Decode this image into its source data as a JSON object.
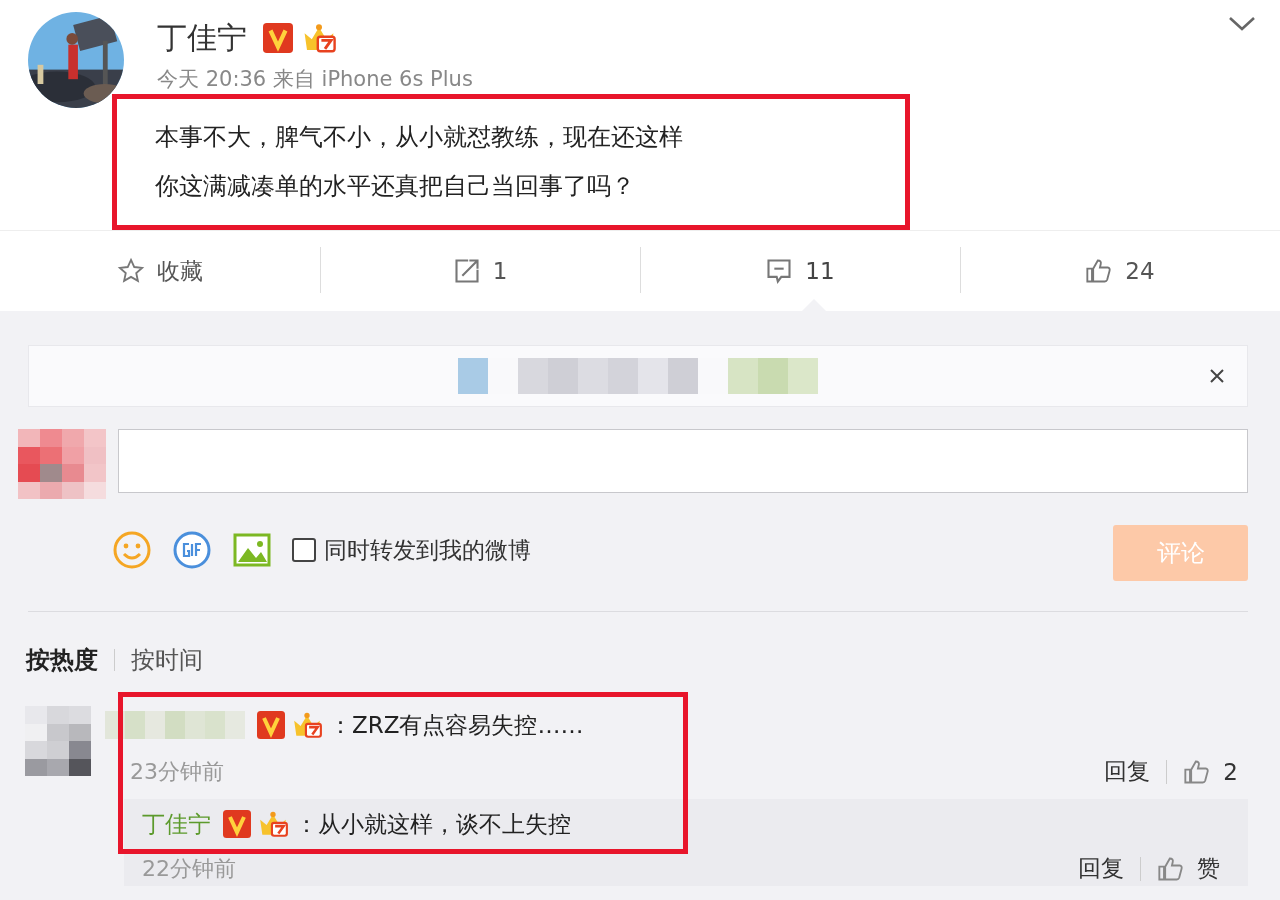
{
  "post": {
    "author": "丁佳宁",
    "verified": true,
    "meta": "今天 20:36 来自 iPhone 6s Plus",
    "lines": [
      "本事不大，脾气不小，从小就怼教练，现在还这样",
      "你这满减凑单的水平还真把自己当回事了吗？"
    ]
  },
  "actions": [
    {
      "kind": "favorite",
      "label": "收藏",
      "selected": false
    },
    {
      "kind": "repost",
      "label": "1",
      "selected": false
    },
    {
      "kind": "comment",
      "label": "11",
      "selected": true
    },
    {
      "kind": "like",
      "label": "24",
      "selected": false
    }
  ],
  "composer": {
    "forward": {
      "label": "同时转发到我的微博",
      "checked": false
    },
    "submit": "评论"
  },
  "sort_tabs": [
    {
      "label": "按热度",
      "selected": true
    },
    {
      "label": "按时间",
      "selected": false
    }
  ],
  "comment": {
    "verified": true,
    "text": "：ZRZ有点容易失控……",
    "time": "23分钟前",
    "reply_label": "回复",
    "likes": "2",
    "reply": {
      "author": "丁佳宁",
      "verified": true,
      "text": "：从小就这样，谈不上失控",
      "time": "22分钟前",
      "reply_label": "回复",
      "like_label": "赞"
    }
  }
}
